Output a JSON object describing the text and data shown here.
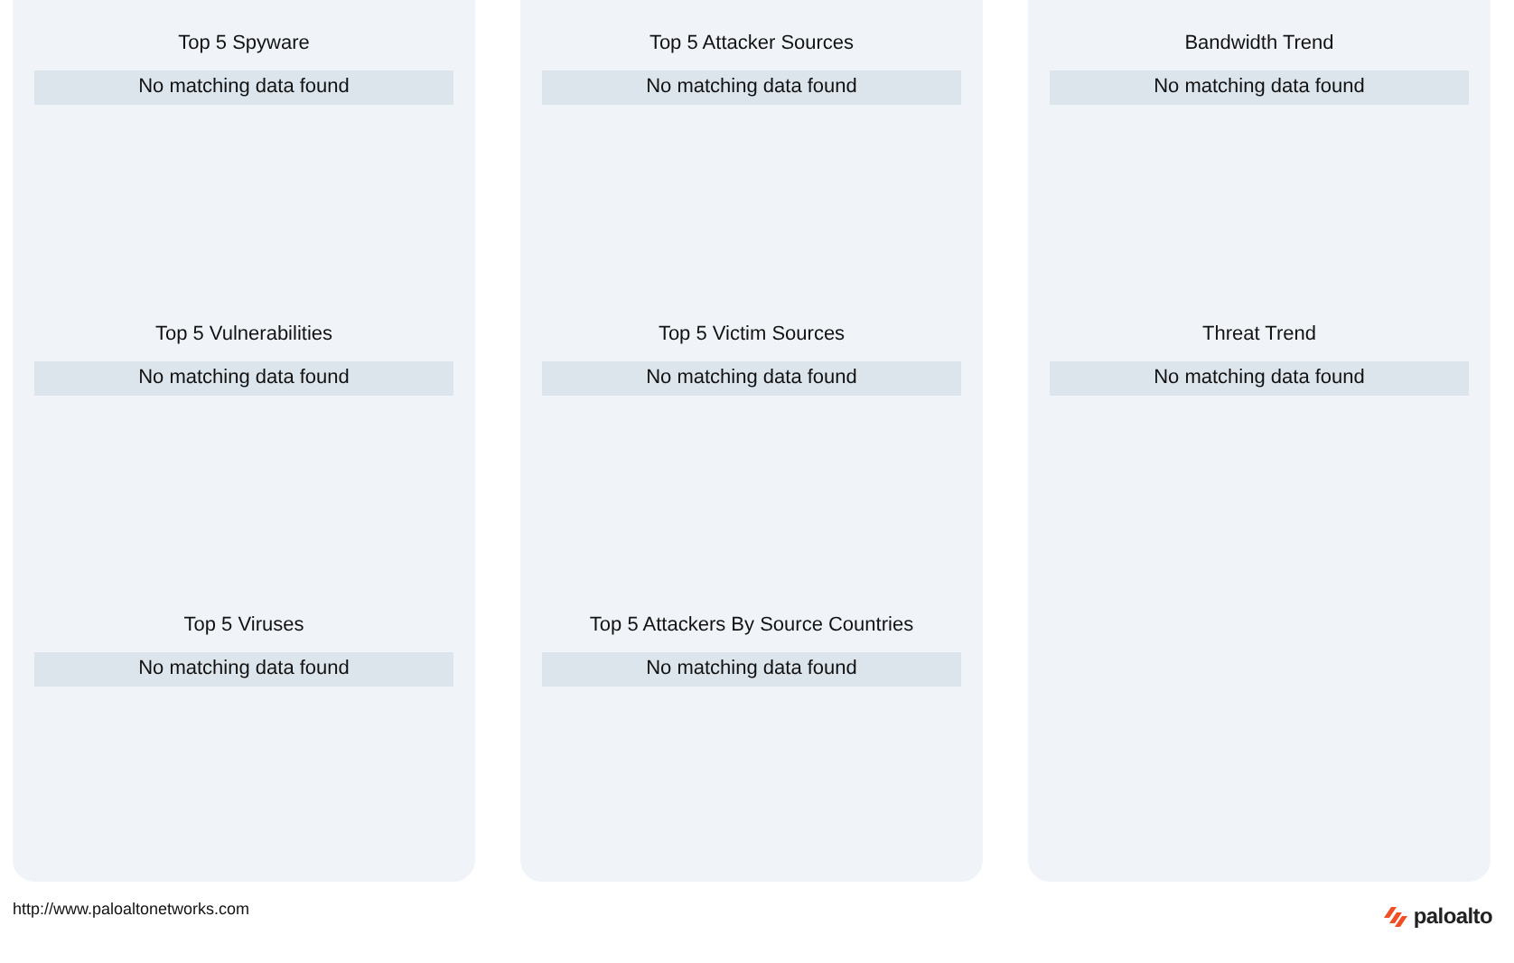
{
  "columns": [
    {
      "widgets": [
        {
          "title": "Top 5 Spyware",
          "message": "No matching data found"
        },
        {
          "title": "Top 5 Vulnerabilities",
          "message": "No matching data found"
        },
        {
          "title": "Top 5 Viruses",
          "message": "No matching data found"
        }
      ]
    },
    {
      "widgets": [
        {
          "title": "Top 5 Attacker Sources",
          "message": "No matching data found"
        },
        {
          "title": "Top 5 Victim Sources",
          "message": "No matching data found"
        },
        {
          "title": "Top 5 Attackers By Source Countries",
          "message": "No matching data found"
        }
      ]
    },
    {
      "widgets": [
        {
          "title": "Bandwidth Trend",
          "message": "No matching data found"
        },
        {
          "title": "Threat Trend",
          "message": "No matching data found"
        }
      ]
    }
  ],
  "footer": {
    "url": "http://www.paloaltonetworks.com",
    "logo": "paloalto"
  }
}
